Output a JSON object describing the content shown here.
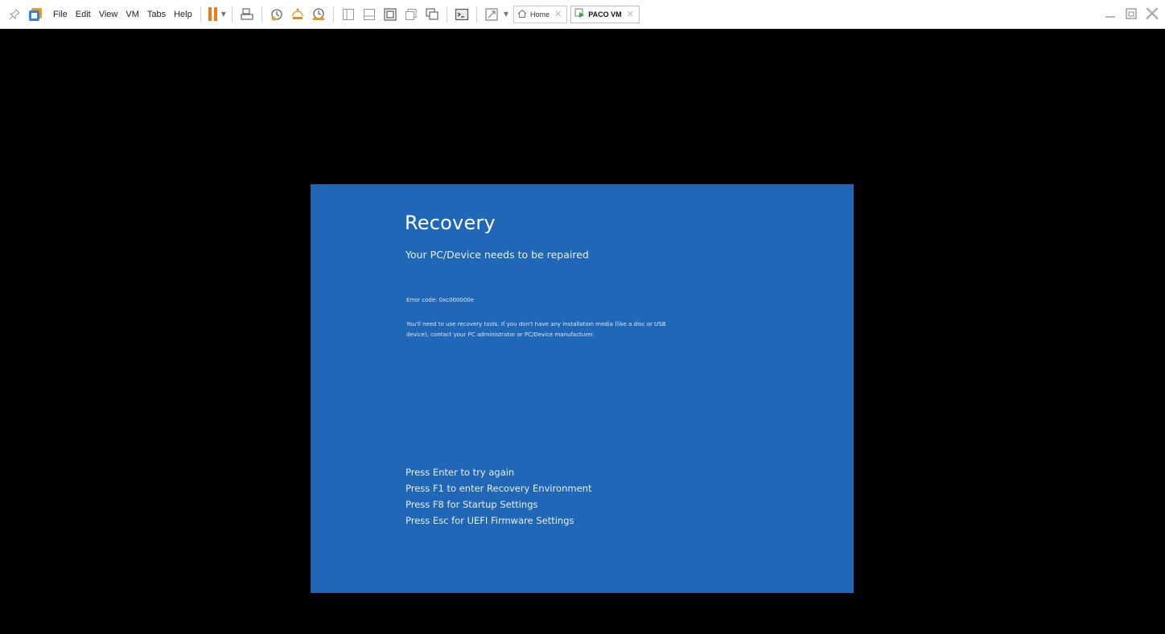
{
  "menu": [
    "File",
    "Edit",
    "View",
    "VM",
    "Tabs",
    "Help"
  ],
  "tabs": [
    {
      "label": "Home",
      "active": false
    },
    {
      "label": "PACO VM",
      "active": true
    }
  ],
  "colors": {
    "screen_bg": "#2167b7",
    "pause_accent": "#f07a1a",
    "vm_background": "#000000"
  },
  "icons": [
    "pin-icon",
    "library-icon",
    "pause-icon",
    "dropdown-caret-icon",
    "send-ctrl-alt-del-icon",
    "snapshot-icon",
    "revert-snapshot-icon",
    "snapshot-manager-icon",
    "show-library-icon",
    "thumbnail-bar-icon",
    "full-screen-icon",
    "unity-icon",
    "fit-guest-icon",
    "console-icon",
    "stretch-icon",
    "home-icon",
    "vm-tab-icon",
    "minimize-icon",
    "restore-icon",
    "close-icon"
  ],
  "recovery": {
    "title": "Recovery",
    "subtitle": "Your PC/Device needs to be repaired",
    "error_code": "Error code: 0xc000000e",
    "body_line1": "You'll need to use recovery tools. If you don't have any installation media (like a disc or USB",
    "body_line2": "device), contact your PC administrator or PC/Device manufacturer.",
    "options": [
      "Press Enter to try again",
      "Press F1 to enter Recovery Environment",
      "Press F8 for Startup Settings",
      "Press Esc for UEFI Firmware Settings"
    ]
  }
}
